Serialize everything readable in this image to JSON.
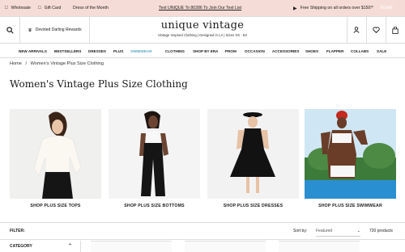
{
  "promo": {
    "wholesale": "Wholesale",
    "gift_card": "Gift Card",
    "dress_of_month": "Dress of the Month",
    "center_text": "Text UNIQUE To 80286 To Join Our Text List",
    "shipping": "Free Shipping on all orders over $150!*",
    "extra": "BOAR"
  },
  "header": {
    "rewards": "Devoted Darling Rewards",
    "logo": "unique vintage",
    "tagline": "Vintage Inspired Clothing | Designed in LA | Sizes XS - 5X"
  },
  "nav": [
    "NEW ARRIVALS",
    "BESTSELLERS",
    "DRESSES",
    "PLUS",
    "SWIMWEAR",
    "CLOTHING",
    "SHOP BY ERA",
    "PROM",
    "OCCASION",
    "ACCESSORIES",
    "SHOES",
    "FLAPPER",
    "COLLABS",
    "SALE"
  ],
  "nav_accent_color": "#5aa7c9",
  "breadcrumb": {
    "home": "Home",
    "sep": "/",
    "current": "Women's Vintage Plus Size Clothing"
  },
  "page_title": "Women's Vintage Plus Size Clothing",
  "categories": [
    {
      "caption": "SHOP PLUS SIZE TOPS"
    },
    {
      "caption": "SHOP PLUS SIZE BOTTOMS"
    },
    {
      "caption": "SHOP PLUS SIZE DRESSES"
    },
    {
      "caption": "SHOP PLUS SIZE SWIMWEAR"
    }
  ],
  "filter": {
    "label": "FILTER:",
    "sort_label": "Sort by:",
    "sort_value": "Featured",
    "count": "720 products"
  },
  "sidebar": {
    "category": "CATEGORY"
  }
}
